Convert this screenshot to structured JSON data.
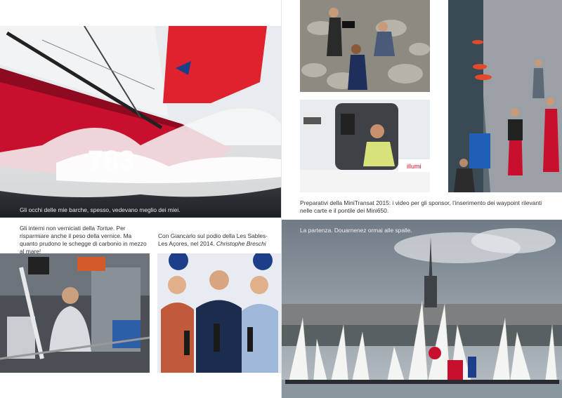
{
  "photos": {
    "racing_boat": {
      "caption": "Gli occhi delle mie barche, spesso, vedevano meglio dei miei.",
      "sail_number": "783"
    },
    "video_shoot": {
      "alt": ""
    },
    "navigation_table": {
      "brand": "illumi"
    },
    "harbor_pontoon": {
      "alt": ""
    },
    "boat_interior": {
      "credit": ""
    },
    "podium": {
      "credit": ""
    },
    "regatta_start": {
      "caption": "La partenza. Douarnenez ormai alle spalle."
    }
  },
  "captions": {
    "interior": {
      "text": "Gli interni non verniciati della ",
      "italic": "Tortue",
      "text2": ". Per risparmiare anche il peso della vernice. Ma quanto prudono le schegge di carbonio in mezzo al mare!"
    },
    "podium": {
      "text": "Con Giancarlo sul podio della Les Sables-Les Açores, nel 2014. ",
      "italic": "Christophe Breschi"
    },
    "prep": {
      "text": "Preparativi della MiniTransat 2015: i video per gli sponsor, l’inserimento dei waypoint rilevanti nelle carte e il pontile dei Mini650."
    }
  },
  "colors": {
    "hull_red": "#c8102e",
    "sail_red": "#e0222f",
    "sea_dark": "#2b2e33",
    "sky_gray": "#8c939a",
    "podium_blue": "#1d3f8a"
  }
}
